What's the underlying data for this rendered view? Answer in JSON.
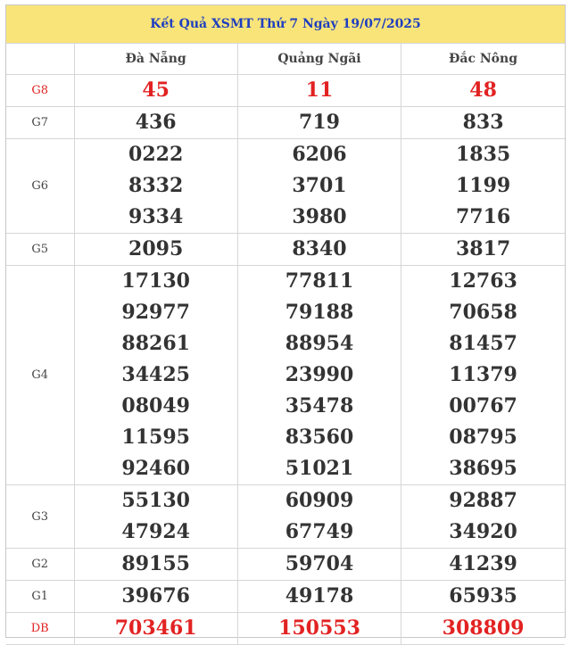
{
  "title": "Kết Quả XSMT Thứ 7 Ngày 19/07/2025",
  "provinces": [
    "Đà Nẵng",
    "Quảng Ngãi",
    "Đắc Nông"
  ],
  "prizes": [
    {
      "label": "G8",
      "red": true,
      "cols": [
        [
          "45"
        ],
        [
          "11"
        ],
        [
          "48"
        ]
      ]
    },
    {
      "label": "G7",
      "red": false,
      "cols": [
        [
          "436"
        ],
        [
          "719"
        ],
        [
          "833"
        ]
      ]
    },
    {
      "label": "G6",
      "red": false,
      "cols": [
        [
          "0222",
          "8332",
          "9334"
        ],
        [
          "6206",
          "3701",
          "3980"
        ],
        [
          "1835",
          "1199",
          "7716"
        ]
      ]
    },
    {
      "label": "G5",
      "red": false,
      "cols": [
        [
          "2095"
        ],
        [
          "8340"
        ],
        [
          "3817"
        ]
      ]
    },
    {
      "label": "G4",
      "red": false,
      "cols": [
        [
          "17130",
          "92977",
          "88261",
          "34425",
          "08049",
          "11595",
          "92460"
        ],
        [
          "77811",
          "79188",
          "88954",
          "23990",
          "35478",
          "83560",
          "51021"
        ],
        [
          "12763",
          "70658",
          "81457",
          "11379",
          "00767",
          "08795",
          "38695"
        ]
      ]
    },
    {
      "label": "G3",
      "red": false,
      "cols": [
        [
          "55130",
          "47924"
        ],
        [
          "60909",
          "67749"
        ],
        [
          "92887",
          "34920"
        ]
      ]
    },
    {
      "label": "G2",
      "red": false,
      "cols": [
        [
          "89155"
        ],
        [
          "59704"
        ],
        [
          "41239"
        ]
      ]
    },
    {
      "label": "G1",
      "red": false,
      "cols": [
        [
          "39676"
        ],
        [
          "49178"
        ],
        [
          "65935"
        ]
      ]
    },
    {
      "label": "DB",
      "red": true,
      "cols": [
        [
          "703461"
        ],
        [
          "150553"
        ],
        [
          "308809"
        ]
      ]
    }
  ]
}
